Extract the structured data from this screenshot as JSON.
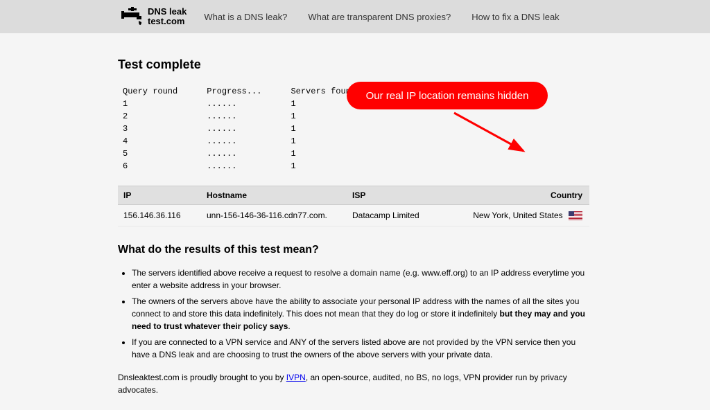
{
  "header": {
    "logo_line1": "DNS leak",
    "logo_line2": "test.com",
    "nav": [
      "What is a DNS leak?",
      "What are transparent DNS proxies?",
      "How to fix a DNS leak"
    ]
  },
  "page_title": "Test complete",
  "progress": {
    "headers": [
      "Query round",
      "Progress...",
      "Servers found"
    ],
    "rows": [
      {
        "round": "1",
        "progress": "......",
        "found": "1"
      },
      {
        "round": "2",
        "progress": "......",
        "found": "1"
      },
      {
        "round": "3",
        "progress": "......",
        "found": "1"
      },
      {
        "round": "4",
        "progress": "......",
        "found": "1"
      },
      {
        "round": "5",
        "progress": "......",
        "found": "1"
      },
      {
        "round": "6",
        "progress": "......",
        "found": "1"
      }
    ]
  },
  "results": {
    "headers": {
      "ip": "IP",
      "hostname": "Hostname",
      "isp": "ISP",
      "country": "Country"
    },
    "rows": [
      {
        "ip": "156.146.36.116",
        "hostname": "unn-156-146-36-116.cdn77.com.",
        "isp": "Datacamp Limited",
        "country": "New York, United States"
      }
    ]
  },
  "explanation": {
    "heading": "What do the results of this test mean?",
    "bullets": [
      "The servers identified above receive a request to resolve a domain name (e.g. www.eff.org) to an IP address everytime you enter a website address in your browser.",
      {
        "pre": "The owners of the servers above have the ability to associate your personal IP address with the names of all the sites you connect to and store this data indefinitely. This does not mean that they do log or store it indefinitely ",
        "bold": "but they may and you need to trust whatever their policy says",
        "post": "."
      },
      "If you are connected to a VPN service and ANY of the servers listed above are not provided by the VPN service then you have a DNS leak and are choosing to trust the owners of the above servers with your private data."
    ],
    "footer_pre": "Dnsleaktest.com is proudly brought to you by ",
    "footer_link": "IVPN",
    "footer_post": ", an open-source, audited, no BS, no logs, VPN provider run by privacy advocates."
  },
  "annotation": "Our real IP location remains hidden"
}
